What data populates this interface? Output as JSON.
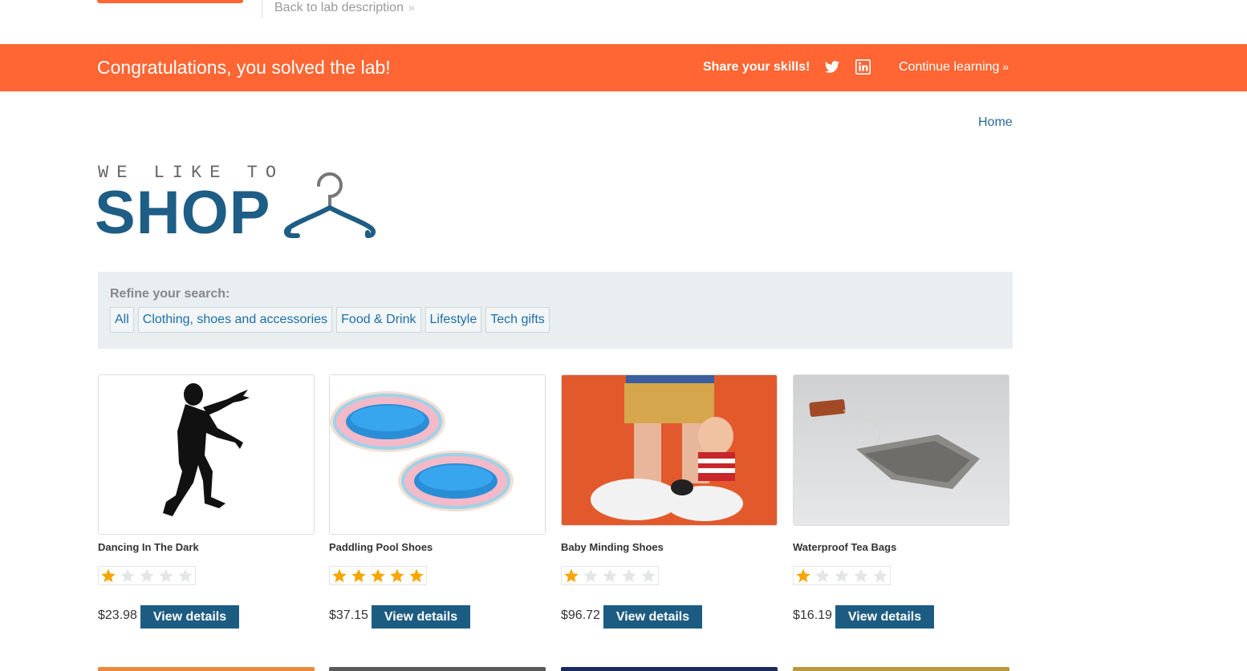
{
  "header": {
    "back_link": "Back to lab description",
    "back_chevron": "»"
  },
  "banner": {
    "message": "Congratulations, you solved the lab!",
    "share_label": "Share your skills!",
    "twitter_icon": "twitter-icon",
    "linkedin_icon": "linkedin-icon",
    "continue_label": "Continue learning",
    "continue_chevron": "»",
    "color": "#ff6633"
  },
  "nav": {
    "home": "Home"
  },
  "brand": {
    "tagline": "WE LIKE TO",
    "word": "SHOP",
    "color": "#1e5d85"
  },
  "filter": {
    "label": "Refine your search:",
    "categories": [
      "All",
      "Clothing, shoes and accessories",
      "Food & Drink",
      "Lifestyle",
      "Tech gifts"
    ]
  },
  "products": [
    {
      "name": "Dancing In The Dark",
      "rating": 1,
      "price": "$23.98",
      "button": "View details"
    },
    {
      "name": "Paddling Pool Shoes",
      "rating": 5,
      "price": "$37.15",
      "button": "View details"
    },
    {
      "name": "Baby Minding Shoes",
      "rating": 1,
      "price": "$96.72",
      "button": "View details"
    },
    {
      "name": "Waterproof Tea Bags",
      "rating": 1,
      "price": "$16.19",
      "button": "View details"
    }
  ]
}
